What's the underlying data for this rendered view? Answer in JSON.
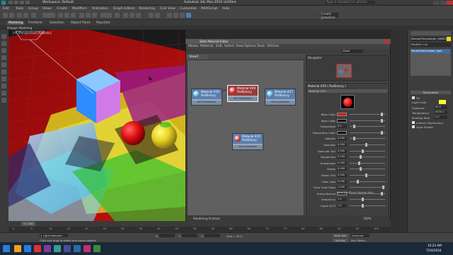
{
  "title_bar": {
    "workspace_label": "Workspace: Default",
    "app_title": "Autodesk 3ds Max 2016   Untitled",
    "search_placeholder": "Type a keyword or phrase"
  },
  "menu": {
    "items": [
      "Edit",
      "Tools",
      "Group",
      "Views",
      "Create",
      "Modifiers",
      "Animation",
      "Graph Editors",
      "Rendering",
      "Civil View",
      "Customize",
      "MAXScript",
      "Help"
    ]
  },
  "ribbon": {
    "tabs": [
      "Modeling",
      "Freeform",
      "Selection",
      "Object Paint",
      "Populate"
    ],
    "sub": "Polygon Modeling",
    "selection_set": "Create Selection Se"
  },
  "viewport": {
    "label": "[+] [Perspective] [Realistic]"
  },
  "slate": {
    "title": "Slate Material Editor",
    "menu": [
      "Modes",
      "Material",
      "Edit",
      "Select",
      "View",
      "Options",
      "Tools",
      "Utilities"
    ],
    "view_tab": "View1",
    "view_dropdown": "View1",
    "navigator_label": "Navigator",
    "param_header": "Material #29  ( PortEmory )",
    "param_sub": "Material #29",
    "status": "Rendering finished",
    "zoom": "100%",
    "nodes": [
      {
        "title": "Material #29",
        "sub": "PortEmory",
        "foot": "ret Connection",
        "color": "#5a7fae",
        "sphere": "#4aa6d8"
      },
      {
        "title": "Material #29",
        "sub": "PortEmory",
        "foot": "ret Connection",
        "color": "#9b3a3a",
        "sphere": "#e02a2a"
      },
      {
        "title": "Material #27",
        "sub": "PortEmory",
        "foot": "ret Connection",
        "color": "#5a7fae",
        "sphere": "#4aa6d8"
      },
      {
        "title": "Material #25",
        "sub": "PortEmory",
        "foot": "ret Connection",
        "color": "#5a7fae",
        "sphere": "#c52a2a"
      }
    ],
    "params": [
      {
        "label": "Base Color",
        "value": "",
        "level": 0.92
      },
      {
        "label": "Spec Color",
        "value": "",
        "level": 0.92
      },
      {
        "label": "Subsurface",
        "value": "0.0",
        "level": 0.1
      },
      {
        "label": "Subsurface Color",
        "value": "",
        "level": 0.92
      },
      {
        "label": "Metallic",
        "value": "0.000",
        "level": 0.1
      },
      {
        "label": "Specular",
        "value": "0.500",
        "level": 0.45
      },
      {
        "label": "Specular Tint",
        "value": "0.000",
        "level": 0.35
      },
      {
        "label": "Roughness",
        "value": "0.250",
        "level": 0.3
      },
      {
        "label": "Anisotropic",
        "value": "0.000",
        "level": 0.25
      },
      {
        "label": "Sheen",
        "value": "0.000",
        "level": 0.3
      },
      {
        "label": "Sheen Tint",
        "value": "0.500",
        "level": 0.45
      },
      {
        "label": "Clear Coat",
        "value": "0.000",
        "level": 0.2
      },
      {
        "label": "Clear Coat Gloss",
        "value": "1.000",
        "level": 0.95
      },
      {
        "label": "Bump Normal",
        "value": "",
        "level": 0.92
      },
      {
        "label": "Frequency",
        "value": "1.0",
        "level": 0.35
      },
      {
        "label": "Input 4275",
        "value": "1.0",
        "level": 0.35
      }
    ],
    "bump_note": "None (PortEmory Normal Map)"
  },
  "cmd_panel": {
    "object_name": "RenderPlaceholder_MNXH",
    "modifier_list": "Modifier List",
    "stack_item": "RenderPlaceholder_light",
    "section": "Parameters",
    "light_on_label": "On",
    "light_color_label": "Light Color",
    "exposure_label": "Exposure",
    "exposure_value": "30.0",
    "temperature_label": "Temperature",
    "temperature_value": "6500.0",
    "shading_label": "Shading Rate",
    "shading_value": "5.0",
    "illum_label": "Indirect Illumination",
    "shadow_label": "Light Shader",
    "light_color": "#ffff33"
  },
  "timeline": {
    "frame": "0 / 100",
    "ticks": [
      "0",
      "5",
      "10",
      "15",
      "20",
      "25",
      "30",
      "35",
      "40",
      "45",
      "50",
      "55",
      "60",
      "65",
      "70",
      "75",
      "80",
      "85",
      "90",
      "95",
      "100"
    ]
  },
  "status": {
    "selection": "1 Light Selected",
    "prompt": "Click and drag to select and move objects",
    "x_label": "X:",
    "y_label": "Y:",
    "z_label": "Z:",
    "grid": "Grid = 10.0",
    "autokey": "Auto Key",
    "setkey": "Set Key",
    "selected": "Selected",
    "key_filters": "Key Filters..."
  },
  "taskbar": {
    "time": "10:23 AM",
    "date": "7/24/2016"
  }
}
